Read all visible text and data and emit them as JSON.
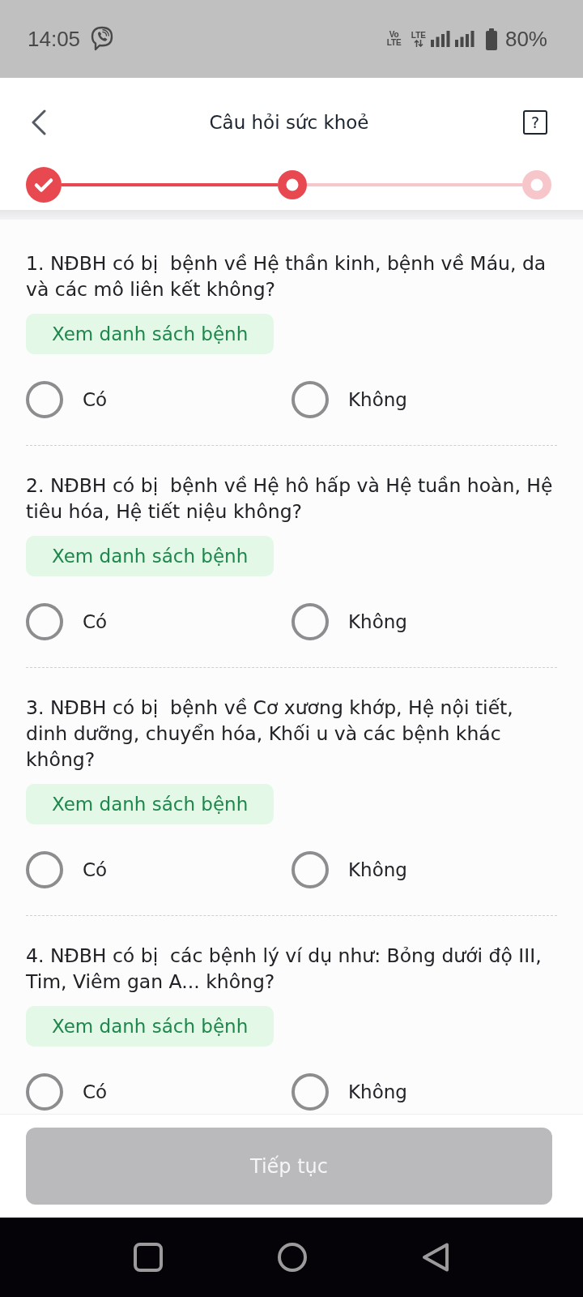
{
  "status_bar": {
    "time": "14:05",
    "volte": [
      "Vo",
      "LTE"
    ],
    "network": "LTE",
    "battery": "80%"
  },
  "header": {
    "title": "Câu hỏi sức khoẻ",
    "help": "?"
  },
  "stepper": [
    {
      "done": true,
      "current": false
    },
    {
      "done": false,
      "current": true
    },
    {
      "done": false,
      "current": false
    }
  ],
  "questions": [
    {
      "text": "1. NĐBH có bị  bệnh về Hệ thần kinh, bệnh về Máu, da và các mô liên kết không?",
      "list_button": "Xem danh sách bệnh",
      "options": [
        {
          "label": "Có",
          "selected": false
        },
        {
          "label": "Không",
          "selected": false
        }
      ]
    },
    {
      "text": "2. NĐBH có bị  bệnh về Hệ hô hấp và Hệ tuần hoàn, Hệ tiêu hóa, Hệ tiết niệu không?",
      "list_button": "Xem danh sách bệnh",
      "options": [
        {
          "label": "Có",
          "selected": false
        },
        {
          "label": "Không",
          "selected": false
        }
      ]
    },
    {
      "text": "3. NĐBH có bị  bệnh về Cơ xương khớp, Hệ nội tiết, dinh dưỡng, chuyển hóa, Khối u và các bệnh khác không?",
      "list_button": "Xem danh sách bệnh",
      "options": [
        {
          "label": "Có",
          "selected": false
        },
        {
          "label": "Không",
          "selected": false
        }
      ]
    },
    {
      "text": "4. NĐBH có bị  các bệnh lý ví dụ như: Bỏng dưới độ III, Tim, Viêm gan A... không?",
      "list_button": "Xem danh sách bệnh",
      "options": [
        {
          "label": "Có",
          "selected": false
        },
        {
          "label": "Không",
          "selected": false
        }
      ]
    }
  ],
  "footer": {
    "button": {
      "label": "Tiếp tục",
      "disabled": true
    }
  }
}
